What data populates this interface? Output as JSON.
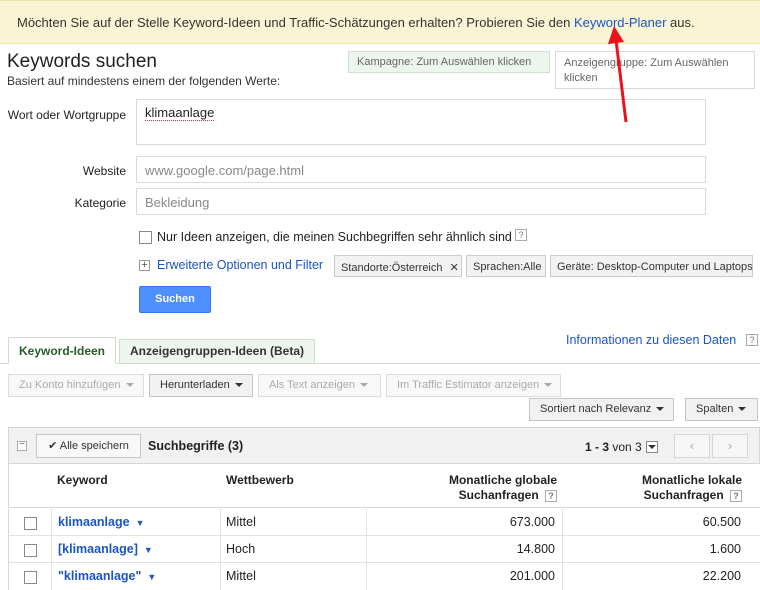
{
  "banner": {
    "text_before": "Möchten Sie auf der Stelle Keyword-Ideen und Traffic-Schätzungen erhalten? Probieren Sie den ",
    "link": "Keyword-Planer",
    "text_after": " aus."
  },
  "header": {
    "title": "Keywords suchen",
    "subtitle": "Basiert auf mindestens einem der folgenden Werte:",
    "campaign": "Kampagne: Zum Auswählen klicken",
    "adgroup": "Anzeigengruppe: Zum Auswählen klicken"
  },
  "form": {
    "word_label": "Wort oder Wortgruppe",
    "word_value": "klimaanlage",
    "website_label": "Website",
    "website_placeholder": "www.google.com/page.html",
    "category_label": "Kategorie",
    "category_placeholder": "Bekleidung",
    "similar_only_label": "Nur Ideen anzeigen, die meinen Suchbegriffen sehr ähnlich sind",
    "help_glyph": "?",
    "advanced_link": "Erweiterte Optionen und Filter",
    "filters": {
      "location": "Standorte:Österreich",
      "language": "Sprachen:Alle",
      "devices": "Geräte: Desktop-Computer und Laptops"
    },
    "search_button": "Suchen"
  },
  "tabs": {
    "keyword_ideas": "Keyword-Ideen",
    "adgroup_ideas": "Anzeigengruppen-Ideen (Beta)",
    "info_link": "Informationen zu diesen Daten"
  },
  "toolbar": {
    "add_to_account": "Zu Konto hinzufügen",
    "download": "Herunterladen",
    "show_as_text": "Als Text anzeigen",
    "traffic_estimator": "Im Traffic Estimator anzeigen",
    "sort": "Sortiert nach Relevanz",
    "columns": "Spalten"
  },
  "results": {
    "save_all": "Alle speichern",
    "title": "Suchbegriffe (3)",
    "pager_range": "1 - 3",
    "pager_total": "von 3",
    "columns": {
      "keyword": "Keyword",
      "competition": "Wettbewerb",
      "global": "Monatliche globale Suchanfragen",
      "local": "Monatliche lokale Suchanfragen"
    },
    "rows": [
      {
        "keyword": "klimaanlage",
        "competition": "Mittel",
        "global": "673.000",
        "local": "60.500"
      },
      {
        "keyword": "[klimaanlage]",
        "competition": "Hoch",
        "global": "14.800",
        "local": "1.600"
      },
      {
        "keyword": "\"klimaanlage\"",
        "competition": "Mittel",
        "global": "201.000",
        "local": "22.200"
      }
    ]
  },
  "colors": {
    "link": "#1a55c8",
    "primary_button": "#4d90fe",
    "banner_bg": "#f9f4d3",
    "annotation_arrow": "#e8121b"
  }
}
